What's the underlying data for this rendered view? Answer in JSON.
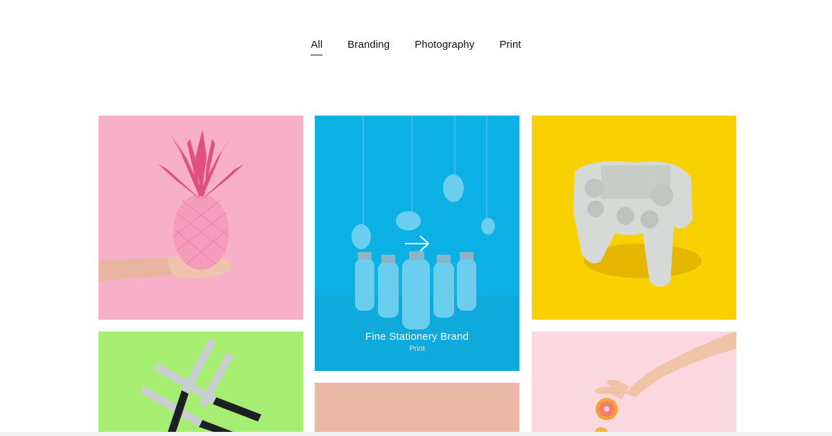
{
  "filters": {
    "items": [
      "All",
      "Branding",
      "Photography",
      "Print"
    ],
    "active": "All"
  },
  "portfolio": {
    "items": [
      {
        "id": "pineapple",
        "bg": "#f7b0c8"
      },
      {
        "id": "bottles",
        "bg": "#0fb2e4",
        "title": "Fine Stationery Brand",
        "category": "Print"
      },
      {
        "id": "controller",
        "bg": "#f9d100"
      },
      {
        "id": "knives",
        "bg": "#a6ee71"
      },
      {
        "id": "peach",
        "bg": "#ebb8a5"
      },
      {
        "id": "grapefruit",
        "bg": "#fbd7df"
      }
    ],
    "hover_icon": "arrow-right-icon"
  }
}
